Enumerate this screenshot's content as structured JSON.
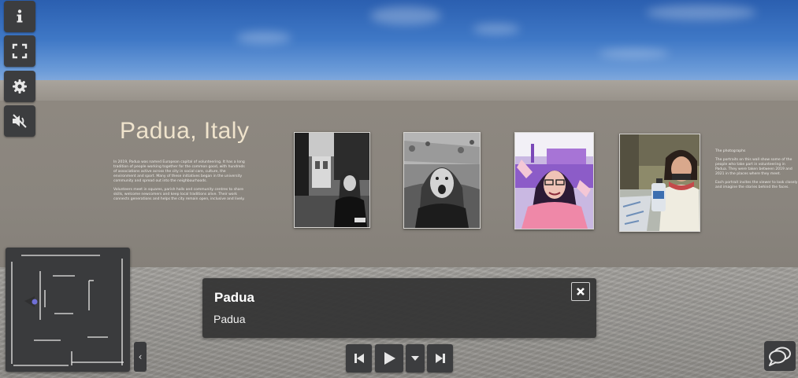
{
  "exhibit": {
    "title": "Padua, Italy",
    "text_left_1": "In 2019, Padua was named European capital of volunteering. It has a long tradition of people working together for the common good, with hundreds of associations active across the city in social care, culture, the environment and sport. Many of these initiatives began in the university community and spread out into the neighbourhoods.",
    "text_left_2": "Volunteers meet in squares, parish halls and community centres to share skills, welcome newcomers and keep local traditions alive. Their work connects generations and helps the city remain open, inclusive and lively.",
    "text_right_1": "The photographs",
    "text_right_2": "The portraits on this wall show some of the people who take part in volunteering in Padua. They were taken between 2019 and 2021 in the places where they meet.",
    "text_right_3": "Each portrait invites the viewer to look closely and imagine the stories behind the faces."
  },
  "info_panel": {
    "title": "Padua",
    "subtitle": "Padua"
  },
  "toolbar": {
    "info_icon": "info-icon",
    "fullscreen_icon": "fullscreen-icon",
    "settings_icon": "gear-icon",
    "sound_icon": "mute-icon"
  },
  "controls": {
    "collapse_glyph": "‹"
  },
  "colors": {
    "panel": "#3c3d3f",
    "title_text": "#efe3cc",
    "minimap_marker": "#6f6fd6"
  }
}
